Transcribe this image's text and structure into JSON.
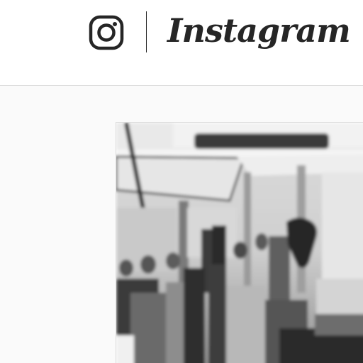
{
  "header": {
    "brand_name": "Instagram",
    "logo_icon": "instagram-camera-icon"
  },
  "feed": {
    "post": {
      "photo_style": "black-and-white blurred interior scene"
    }
  },
  "colors": {
    "header_background": "#ffffff",
    "page_background": "#fafafa",
    "text": "#262626",
    "border": "#dbdbdb"
  }
}
